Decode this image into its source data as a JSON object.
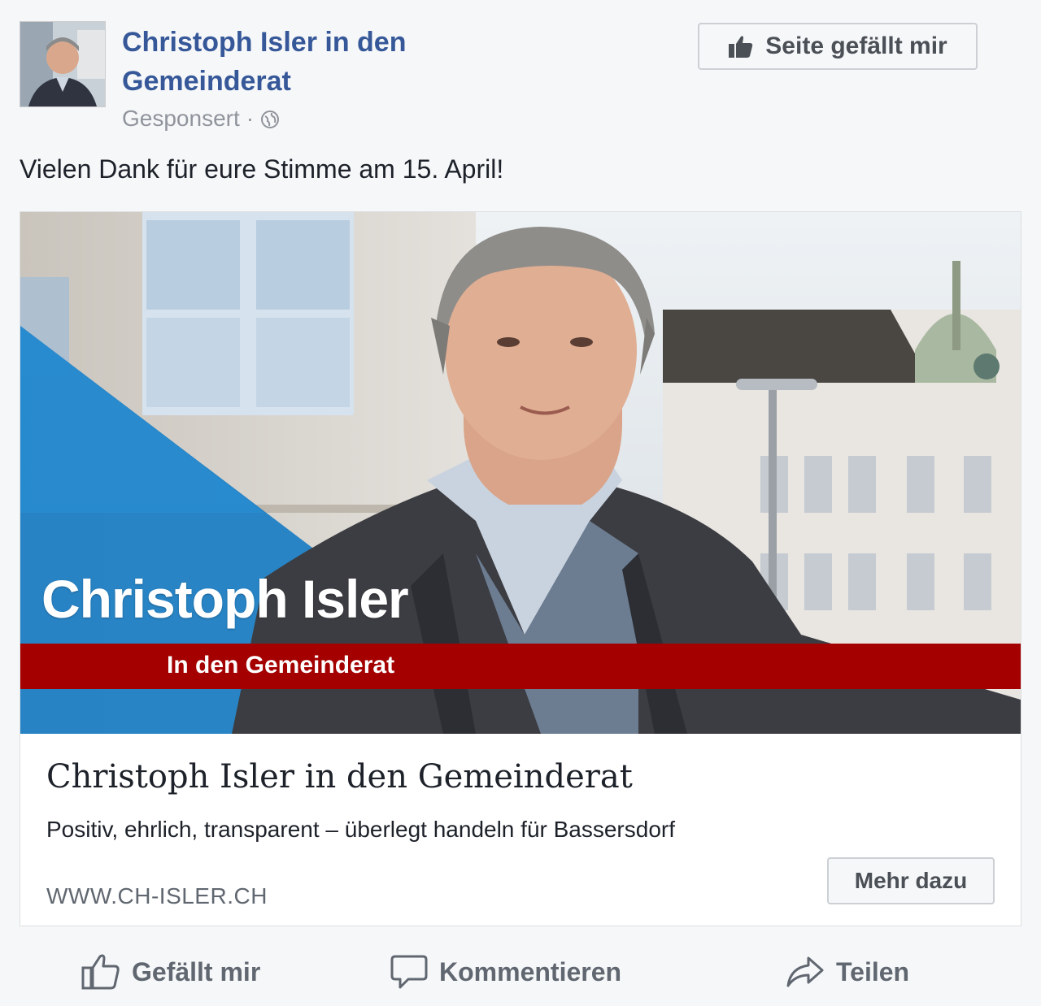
{
  "header": {
    "page_name": "Christoph Isler in den Gemeinderat",
    "sponsored": "Gesponsert",
    "separator": "·",
    "like_page_button": "Seite gefällt mir"
  },
  "post": {
    "text": "Vielen Dank für eure Stimme am 15. April!"
  },
  "ad_image": {
    "overlay_name": "Christoph Isler",
    "overlay_subtitle": "In den Gemeinderat"
  },
  "card": {
    "title": "Christoph Isler in den Gemeinderat",
    "description": "Positiv, ehrlich, transparent – überlegt handeln für Bassersdorf",
    "domain": "WWW.CH-ISLER.CH",
    "cta": "Mehr dazu"
  },
  "actions": {
    "like": "Gefällt mir",
    "comment": "Kommentieren",
    "share": "Teilen"
  },
  "colors": {
    "link_blue": "#365899",
    "band_red": "#a40000",
    "triangle_blue": "#1f7fc4",
    "muted_text": "#90949c"
  }
}
